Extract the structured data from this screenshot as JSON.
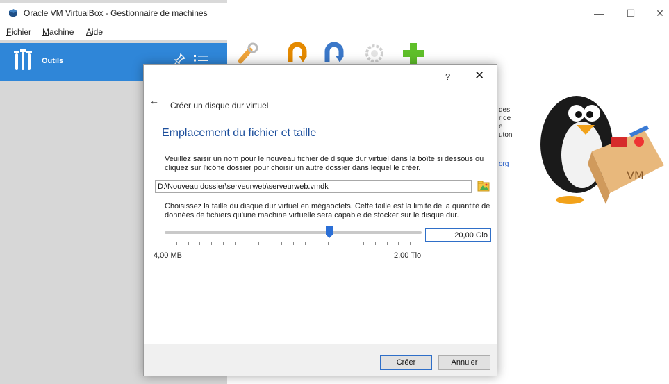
{
  "window": {
    "title": "Oracle VM VirtualBox - Gestionnaire de machines",
    "controls": {
      "minimize": "—",
      "maximize": "☐",
      "close": "✕"
    }
  },
  "menu": {
    "items": [
      {
        "label": "Fichier",
        "mnemonic": "F"
      },
      {
        "label": "Machine",
        "mnemonic": "M"
      },
      {
        "label": "Aide",
        "mnemonic": "A"
      }
    ]
  },
  "sidebar": {
    "tools_label": "Outils",
    "accent_color": "#2f86d8"
  },
  "toolbar": {
    "icons": [
      "wrench-icon",
      "import-icon",
      "export-icon",
      "settings-gear-icon",
      "add-icon"
    ]
  },
  "welcome_fragments": {
    "line1": "des",
    "line2": "r de",
    "line3": "e",
    "line4": "uton",
    "link": "org"
  },
  "dialog": {
    "help_label": "?",
    "close_label": "✕",
    "back_label": "←",
    "wizard_title": "Créer un disque dur virtuel",
    "heading": "Emplacement du fichier et taille",
    "location_text": "Veuillez saisir un nom pour le nouveau fichier de disque dur virtuel dans la boîte si dessous ou cliquez sur l'icône dossier pour choisir un autre dossier dans lequel le créer.",
    "file_path": "D:\\Nouveau dossier\\serveurweb\\serveurweb.vmdk",
    "size_text": "Choisissez la taille du disque dur virtuel en mégaoctets. Cette taille est la limite de la quantité de données de fichiers qu'une machine virtuelle sera capable de stocker sur le disque dur.",
    "size_value": "20,00 Gio",
    "slider_min_label": "4,00 MB",
    "slider_max_label": "2,00 Tio",
    "create_label": "Créer",
    "cancel_label": "Annuler"
  }
}
